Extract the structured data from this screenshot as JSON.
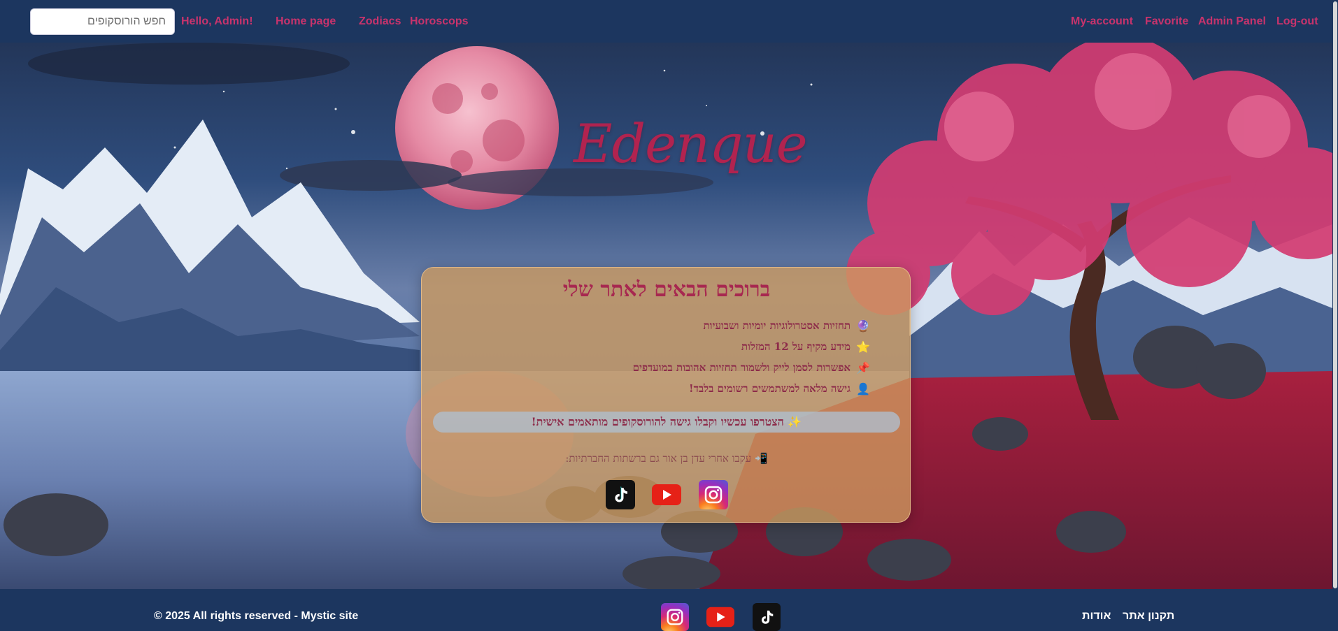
{
  "search": {
    "placeholder": "חפש הורוסקופים"
  },
  "nav": {
    "greeting": "Hello, Admin!",
    "home": "Home page",
    "zodiacs": "Zodiacs",
    "horoscops": "Horoscops",
    "my_account": "My-account",
    "favorite": "Favorite",
    "admin_panel": "Admin Panel",
    "logout": "Log-out"
  },
  "hero": {
    "logo": "Edenque"
  },
  "card": {
    "title": "ברוכים הבאים לאתר שלי",
    "features": [
      {
        "icon": "crystal-ball-icon",
        "glyph": "🔮",
        "text": "תחזיות אסטרולוגיות יומיות ושבועיות"
      },
      {
        "icon": "star-icon",
        "glyph": "⭐",
        "text": "מידע מקיף על 12 המזלות"
      },
      {
        "icon": "pushpin-icon",
        "glyph": "📌",
        "text": "אפשרות לסמן לייק ולשמור תחזיות אהובות במועדפים"
      },
      {
        "icon": "user-icon",
        "glyph": "👤",
        "text": "גישה מלאה למשתמשים רשומים בלבד!"
      }
    ],
    "banner": "✨ הצטרפו עכשיו וקבלו גישה להורוסקופים מותאמים אישית!",
    "follow": "📲 עקבו אחרי עדן בן אור גם ברשתות החברתיות:"
  },
  "footer": {
    "copyright": "© 2025 All rights reserved - Mystic site",
    "about": "אודות",
    "terms": "תקנון אתר"
  },
  "colors": {
    "navbar": "#1c365f",
    "accent": "#c8336c",
    "card": "#ce9b5f",
    "title": "#a72850"
  }
}
